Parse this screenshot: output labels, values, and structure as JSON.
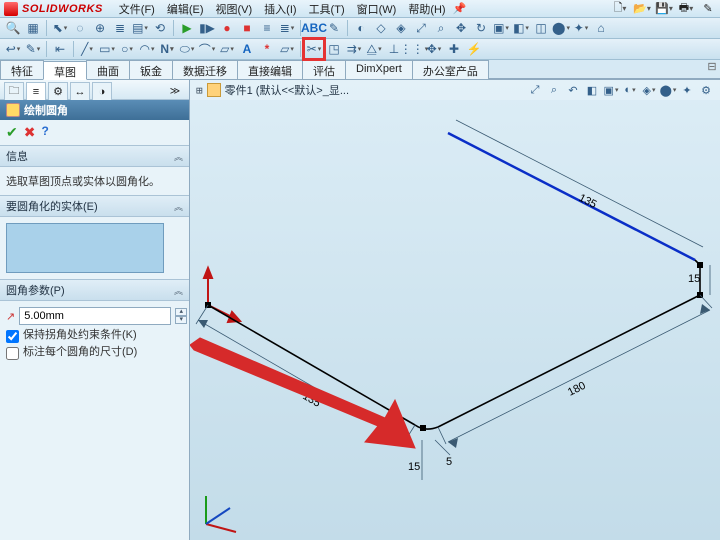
{
  "app": {
    "name": "SOLIDWORKS"
  },
  "menu": {
    "file": "文件(F)",
    "edit": "编辑(E)",
    "view": "视图(V)",
    "insert": "插入(I)",
    "tools": "工具(T)",
    "window": "窗口(W)",
    "help": "帮助(H)"
  },
  "toolbar1": {
    "icons": [
      "tb-select",
      "tb-lasso",
      "tb-filter",
      "tb-target",
      "tb-listsel",
      "tb-prev"
    ],
    "icons2": [
      "tb-play",
      "tb-step",
      "tb-rec",
      "tb-stop",
      "tb-script",
      "tb-macro"
    ],
    "icons3": [
      "tb-spellcheck",
      "tb-annot"
    ],
    "icons4": [
      "tb-shaded",
      "tb-wire",
      "tb-hlr",
      "tb-view1",
      "tb-view2",
      "tb-zoom",
      "tb-pan",
      "tb-rotate",
      "tb-fit",
      "tb-prevview",
      "tb-section",
      "tb-savedview",
      "tb-scene"
    ]
  },
  "toolbar2": {
    "icons_left": [
      "sk-exit",
      "sk-sketch",
      "sk-dim"
    ],
    "icons_shapes": [
      "sk-line",
      "sk-rect",
      "sk-circle",
      "sk-arc",
      "sk-spline",
      "sk-ellipse",
      "sk-fillet",
      "sk-slot",
      "sk-polygon",
      "sk-point",
      "sk-text",
      "sk-axis",
      "sk-chamfer"
    ],
    "icons_ops": [
      "sk-trim",
      "sk-extend",
      "sk-offset",
      "sk-mirror",
      "sk-pattern",
      "sk-convert",
      "sk-move",
      "sk-scale",
      "sk-repair",
      "sk-quick"
    ]
  },
  "ribbon": {
    "tabs": [
      "特征",
      "草图",
      "曲面",
      "钣金",
      "数据迁移",
      "直接编辑",
      "评估",
      "DimXpert",
      "办公室产品"
    ],
    "active": 1
  },
  "pm_tabs": [
    "feature-tree",
    "property-mgr",
    "config-mgr",
    "dim-mgr",
    "display-mgr"
  ],
  "panel": {
    "title": "绘制圆角",
    "info_head": "信息",
    "info_body": "选取草图顶点或实体以圆角化。",
    "entities_head": "要圆角化的实体(E)",
    "params_head": "圆角参数(P)",
    "radius_value": "5.00mm",
    "keep_constraints": "保持拐角处约束条件(K)",
    "dim_each": "标注每个圆角的尺寸(D)"
  },
  "viewport": {
    "doc_title": "零件1  (默认<<默认>_显...",
    "dims": {
      "top": "135",
      "left": "135",
      "right": "180",
      "h_small": "15",
      "r": "5"
    }
  },
  "chart_data": null
}
